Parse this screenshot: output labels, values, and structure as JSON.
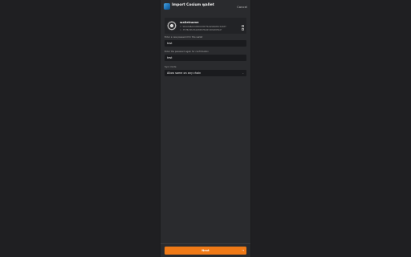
{
  "header": {
    "title": "Import Cosium wallet",
    "badge": "⇄",
    "cancel_label": "Cancel"
  },
  "wallet_card": {
    "name": "walletname",
    "address_1_key": "H:",
    "address_1": "9bcbc0e8e6c4d2b9c4d2b7f4a2e9a9e8d4c2a1b9f",
    "address_2_key": "G:",
    "address_2": "3f1f8e7d6c5b4a39281f0e2d3c4b5a6978e1f"
  },
  "form": {
    "field_1_label": "Enter a new password for this wallet",
    "field_1_value": "test",
    "field_2_label": "Enter the password again for confirmation",
    "field_2_value": "test",
    "select_label": "Sync mode",
    "select_value": "Allow same on any chain"
  },
  "footer": {
    "next_label": "Next",
    "next_arrow": "→"
  },
  "colors": {
    "accent": "#f07a17",
    "panel": "#2a2b2e",
    "background": "#1f1f22"
  }
}
